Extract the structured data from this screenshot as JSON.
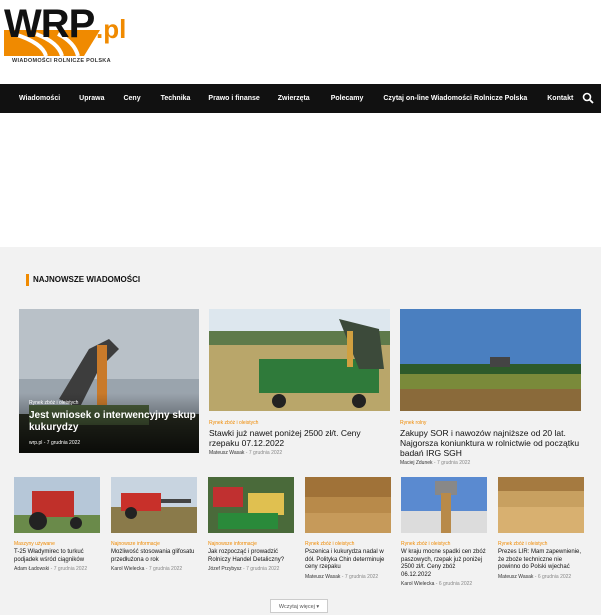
{
  "logo": {
    "main": "WRP",
    "suffix": ".pl",
    "subtitle": "WIADOMOŚCI ROLNICZE POLSKA"
  },
  "nav": {
    "items": [
      "Wiadomości",
      "Uprawa",
      "Ceny",
      "Technika",
      "Prawo i finanse",
      "Zwierzęta",
      "Polecamy",
      "Czytaj on-line Wiadomości Rolnicze Polska",
      "Kontakt"
    ],
    "search_icon": "search-icon"
  },
  "section": {
    "title": "NAJNOWSZE WIADOMOŚCI"
  },
  "featured": [
    {
      "category": "Rynek zbóż i oleistych",
      "title": "Jest wniosek o interwencyjny skup kukurydzy",
      "author": "wrp.pl",
      "date": "7 grudnia 2022"
    },
    {
      "category": "Rynek zbóż i oleistych",
      "title": "Stawki już nawet poniżej 2500 zł/t. Ceny rzepaku 07.12.2022",
      "author": "Mateusz Wasak",
      "date": "7 grudnia 2022"
    },
    {
      "category": "Rynek rolny",
      "title": "Zakupy SOR i nawozów najniższe od 20 lat. Najgorsza koniunktura w rolnictwie od początku badań IRG SGH",
      "author": "Maciej Zdunek",
      "date": "7 grudnia 2022"
    }
  ],
  "small": [
    {
      "category": "Maszyny używane",
      "title": "T-25 Władymirec to turkuć podjadek wśród ciągników",
      "author": "Adam Ładowski",
      "date": "7 grudnia 2022"
    },
    {
      "category": "Najnowsze informacje",
      "title": "Możliwość stosowania glifosatu przedłużona o rok",
      "author": "Karol Wielecka",
      "date": "7 grudnia 2022"
    },
    {
      "category": "Najnowsze informacje",
      "title": "Jak rozpocząć i prowadzić Rolniczy Handel Detaliczny?",
      "author": "Józef Przybysz",
      "date": "7 grudnia 2022"
    },
    {
      "category": "Rynek zbóż i oleistych",
      "title": "Pszenica i kukurydza nadal w dół. Polityka Chin determinuje ceny rzepaku",
      "author": "Mateusz Wasak",
      "date": "7 grudnia 2022"
    },
    {
      "category": "Rynek zbóż i oleistych",
      "title": "W kraju mocne spadki cen zbóż paszowych, rzepak już poniżej 2500 zł/t. Ceny zbóż 06.12.2022",
      "author": "Karol Wielecka",
      "date": "6 grudnia 2022"
    },
    {
      "category": "Rynek zbóż i oleistych",
      "title": "Prezes LIR: Mam zapewnienie, że zboże techniczne nie powinno do Polski wjechać",
      "author": "Mateusz Wasak",
      "date": "6 grudnia 2022"
    }
  ],
  "more_button": "Wczytaj więcej",
  "colors": {
    "accent": "#f08a00",
    "nav_bg": "#111111"
  }
}
